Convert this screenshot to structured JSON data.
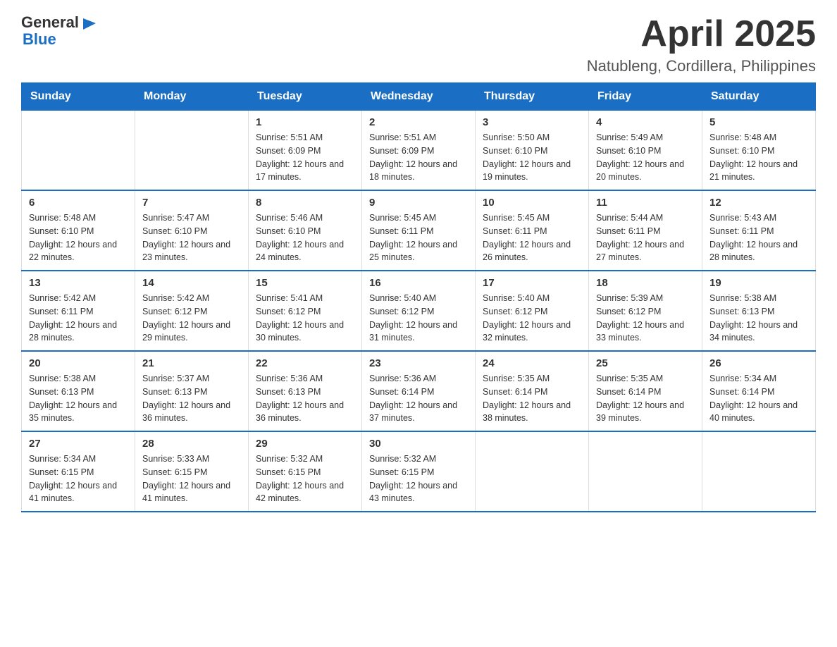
{
  "header": {
    "logo": {
      "text_general": "General",
      "triangle_icon": "▶",
      "text_blue": "Blue"
    },
    "title": "April 2025",
    "location": "Natubleng, Cordillera, Philippines"
  },
  "calendar": {
    "days_of_week": [
      "Sunday",
      "Monday",
      "Tuesday",
      "Wednesday",
      "Thursday",
      "Friday",
      "Saturday"
    ],
    "weeks": [
      [
        {
          "day": "",
          "sunrise": "",
          "sunset": "",
          "daylight": ""
        },
        {
          "day": "",
          "sunrise": "",
          "sunset": "",
          "daylight": ""
        },
        {
          "day": "1",
          "sunrise": "Sunrise: 5:51 AM",
          "sunset": "Sunset: 6:09 PM",
          "daylight": "Daylight: 12 hours and 17 minutes."
        },
        {
          "day": "2",
          "sunrise": "Sunrise: 5:51 AM",
          "sunset": "Sunset: 6:09 PM",
          "daylight": "Daylight: 12 hours and 18 minutes."
        },
        {
          "day": "3",
          "sunrise": "Sunrise: 5:50 AM",
          "sunset": "Sunset: 6:10 PM",
          "daylight": "Daylight: 12 hours and 19 minutes."
        },
        {
          "day": "4",
          "sunrise": "Sunrise: 5:49 AM",
          "sunset": "Sunset: 6:10 PM",
          "daylight": "Daylight: 12 hours and 20 minutes."
        },
        {
          "day": "5",
          "sunrise": "Sunrise: 5:48 AM",
          "sunset": "Sunset: 6:10 PM",
          "daylight": "Daylight: 12 hours and 21 minutes."
        }
      ],
      [
        {
          "day": "6",
          "sunrise": "Sunrise: 5:48 AM",
          "sunset": "Sunset: 6:10 PM",
          "daylight": "Daylight: 12 hours and 22 minutes."
        },
        {
          "day": "7",
          "sunrise": "Sunrise: 5:47 AM",
          "sunset": "Sunset: 6:10 PM",
          "daylight": "Daylight: 12 hours and 23 minutes."
        },
        {
          "day": "8",
          "sunrise": "Sunrise: 5:46 AM",
          "sunset": "Sunset: 6:10 PM",
          "daylight": "Daylight: 12 hours and 24 minutes."
        },
        {
          "day": "9",
          "sunrise": "Sunrise: 5:45 AM",
          "sunset": "Sunset: 6:11 PM",
          "daylight": "Daylight: 12 hours and 25 minutes."
        },
        {
          "day": "10",
          "sunrise": "Sunrise: 5:45 AM",
          "sunset": "Sunset: 6:11 PM",
          "daylight": "Daylight: 12 hours and 26 minutes."
        },
        {
          "day": "11",
          "sunrise": "Sunrise: 5:44 AM",
          "sunset": "Sunset: 6:11 PM",
          "daylight": "Daylight: 12 hours and 27 minutes."
        },
        {
          "day": "12",
          "sunrise": "Sunrise: 5:43 AM",
          "sunset": "Sunset: 6:11 PM",
          "daylight": "Daylight: 12 hours and 28 minutes."
        }
      ],
      [
        {
          "day": "13",
          "sunrise": "Sunrise: 5:42 AM",
          "sunset": "Sunset: 6:11 PM",
          "daylight": "Daylight: 12 hours and 28 minutes."
        },
        {
          "day": "14",
          "sunrise": "Sunrise: 5:42 AM",
          "sunset": "Sunset: 6:12 PM",
          "daylight": "Daylight: 12 hours and 29 minutes."
        },
        {
          "day": "15",
          "sunrise": "Sunrise: 5:41 AM",
          "sunset": "Sunset: 6:12 PM",
          "daylight": "Daylight: 12 hours and 30 minutes."
        },
        {
          "day": "16",
          "sunrise": "Sunrise: 5:40 AM",
          "sunset": "Sunset: 6:12 PM",
          "daylight": "Daylight: 12 hours and 31 minutes."
        },
        {
          "day": "17",
          "sunrise": "Sunrise: 5:40 AM",
          "sunset": "Sunset: 6:12 PM",
          "daylight": "Daylight: 12 hours and 32 minutes."
        },
        {
          "day": "18",
          "sunrise": "Sunrise: 5:39 AM",
          "sunset": "Sunset: 6:12 PM",
          "daylight": "Daylight: 12 hours and 33 minutes."
        },
        {
          "day": "19",
          "sunrise": "Sunrise: 5:38 AM",
          "sunset": "Sunset: 6:13 PM",
          "daylight": "Daylight: 12 hours and 34 minutes."
        }
      ],
      [
        {
          "day": "20",
          "sunrise": "Sunrise: 5:38 AM",
          "sunset": "Sunset: 6:13 PM",
          "daylight": "Daylight: 12 hours and 35 minutes."
        },
        {
          "day": "21",
          "sunrise": "Sunrise: 5:37 AM",
          "sunset": "Sunset: 6:13 PM",
          "daylight": "Daylight: 12 hours and 36 minutes."
        },
        {
          "day": "22",
          "sunrise": "Sunrise: 5:36 AM",
          "sunset": "Sunset: 6:13 PM",
          "daylight": "Daylight: 12 hours and 36 minutes."
        },
        {
          "day": "23",
          "sunrise": "Sunrise: 5:36 AM",
          "sunset": "Sunset: 6:14 PM",
          "daylight": "Daylight: 12 hours and 37 minutes."
        },
        {
          "day": "24",
          "sunrise": "Sunrise: 5:35 AM",
          "sunset": "Sunset: 6:14 PM",
          "daylight": "Daylight: 12 hours and 38 minutes."
        },
        {
          "day": "25",
          "sunrise": "Sunrise: 5:35 AM",
          "sunset": "Sunset: 6:14 PM",
          "daylight": "Daylight: 12 hours and 39 minutes."
        },
        {
          "day": "26",
          "sunrise": "Sunrise: 5:34 AM",
          "sunset": "Sunset: 6:14 PM",
          "daylight": "Daylight: 12 hours and 40 minutes."
        }
      ],
      [
        {
          "day": "27",
          "sunrise": "Sunrise: 5:34 AM",
          "sunset": "Sunset: 6:15 PM",
          "daylight": "Daylight: 12 hours and 41 minutes."
        },
        {
          "day": "28",
          "sunrise": "Sunrise: 5:33 AM",
          "sunset": "Sunset: 6:15 PM",
          "daylight": "Daylight: 12 hours and 41 minutes."
        },
        {
          "day": "29",
          "sunrise": "Sunrise: 5:32 AM",
          "sunset": "Sunset: 6:15 PM",
          "daylight": "Daylight: 12 hours and 42 minutes."
        },
        {
          "day": "30",
          "sunrise": "Sunrise: 5:32 AM",
          "sunset": "Sunset: 6:15 PM",
          "daylight": "Daylight: 12 hours and 43 minutes."
        },
        {
          "day": "",
          "sunrise": "",
          "sunset": "",
          "daylight": ""
        },
        {
          "day": "",
          "sunrise": "",
          "sunset": "",
          "daylight": ""
        },
        {
          "day": "",
          "sunrise": "",
          "sunset": "",
          "daylight": ""
        }
      ]
    ]
  }
}
